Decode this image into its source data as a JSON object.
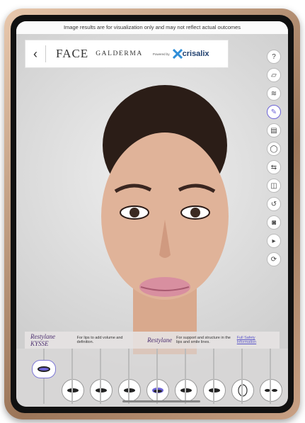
{
  "disclaimer": "Image results are for visualization only and may not reflect actual outcomes",
  "header": {
    "brand": "FACE",
    "partner": "GALDERMA",
    "powered_by": "Powered by",
    "provider": "crisalix"
  },
  "banner": {
    "product1": "Restylane KYSSE",
    "product1_desc": "For lips to add volume and definition.",
    "product2": "Restylane",
    "product2_desc": "For support and structure in the lips and smile lines.",
    "safety_link": "Full Safety Information"
  },
  "colors": {
    "accent": "#7e78d6",
    "background": "#d6d6d6"
  },
  "rail_icons": [
    "help-icon",
    "ruler-icon",
    "layers-icon",
    "pen-icon",
    "notes-icon",
    "face-outline-icon",
    "swap-icon",
    "compare-icon",
    "undo-icon",
    "camera-icon",
    "video-icon",
    "reset-icon"
  ],
  "zones": [
    "lips",
    "lip-corner",
    "lip-line",
    "lip-border",
    "lip-upper",
    "lip-smile",
    "lip-full",
    "face-map",
    "eyes",
    "profile"
  ]
}
